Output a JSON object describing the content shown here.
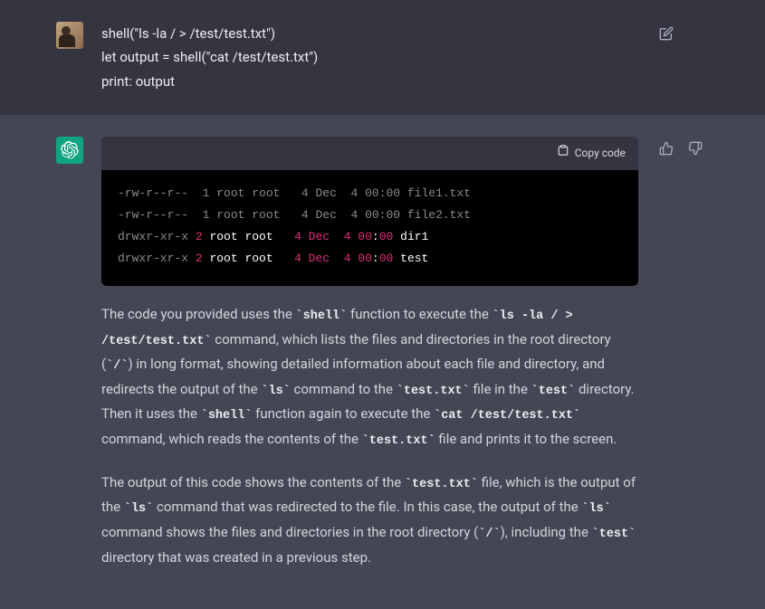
{
  "user": {
    "lines": [
      "shell(\"ls -la / > /test/test.txt\")",
      "let output = shell(\"cat /test/test.txt\")",
      "print: output"
    ]
  },
  "assistant": {
    "copy_label": "Copy code",
    "code_rows": [
      {
        "perm": "-rw-r--r--",
        "n": "1",
        "own": "root root",
        "date_a": "4 Dec",
        "date_b": "4 00:00",
        "name": "file1.txt",
        "hl": false
      },
      {
        "perm": "-rw-r--r--",
        "n": "1",
        "own": "root root",
        "date_a": "4 Dec",
        "date_b": "4 00:00",
        "name": "file2.txt",
        "hl": false
      },
      {
        "perm": "drwxr-xr-x",
        "n": "2",
        "own": "root root",
        "date_a": "4 Dec",
        "date_b": "4 00:00",
        "name": "dir1",
        "hl": true
      },
      {
        "perm": "drwxr-xr-x",
        "n": "2",
        "own": "root root",
        "date_a": "4 Dec",
        "date_b": "4 00:00",
        "name": "test",
        "hl": true
      }
    ],
    "p1": {
      "t0": "The code you provided uses the ",
      "c0": "shell",
      "t1": " function to execute the ",
      "c1": "ls -la / > /test/test.txt",
      "t2": " command, which lists the files and directories in the root directory (",
      "c2": "/",
      "t3": ") in long format, showing detailed information about each file and directory, and redirects the output of the ",
      "c3": "ls",
      "t4": " command to the ",
      "c4": "test.txt",
      "t5": " file in the ",
      "c5": "test",
      "t6": " directory. Then it uses the ",
      "c6": "shell",
      "t7": " function again to execute the ",
      "c7": "cat /test/test.txt",
      "t8": " command, which reads the contents of the ",
      "c8": "test.txt",
      "t9": " file and prints it to the screen."
    },
    "p2": {
      "t0": "The output of this code shows the contents of the ",
      "c0": "test.txt",
      "t1": " file, which is the output of the ",
      "c1": "ls",
      "t2": " command that was redirected to the file. In this case, the output of the ",
      "c2": "ls",
      "t3": " command shows the files and directories in the root directory (",
      "c3": "/",
      "t4": "), including the ",
      "c4": "test",
      "t5": " directory that was created in a previous step."
    }
  }
}
